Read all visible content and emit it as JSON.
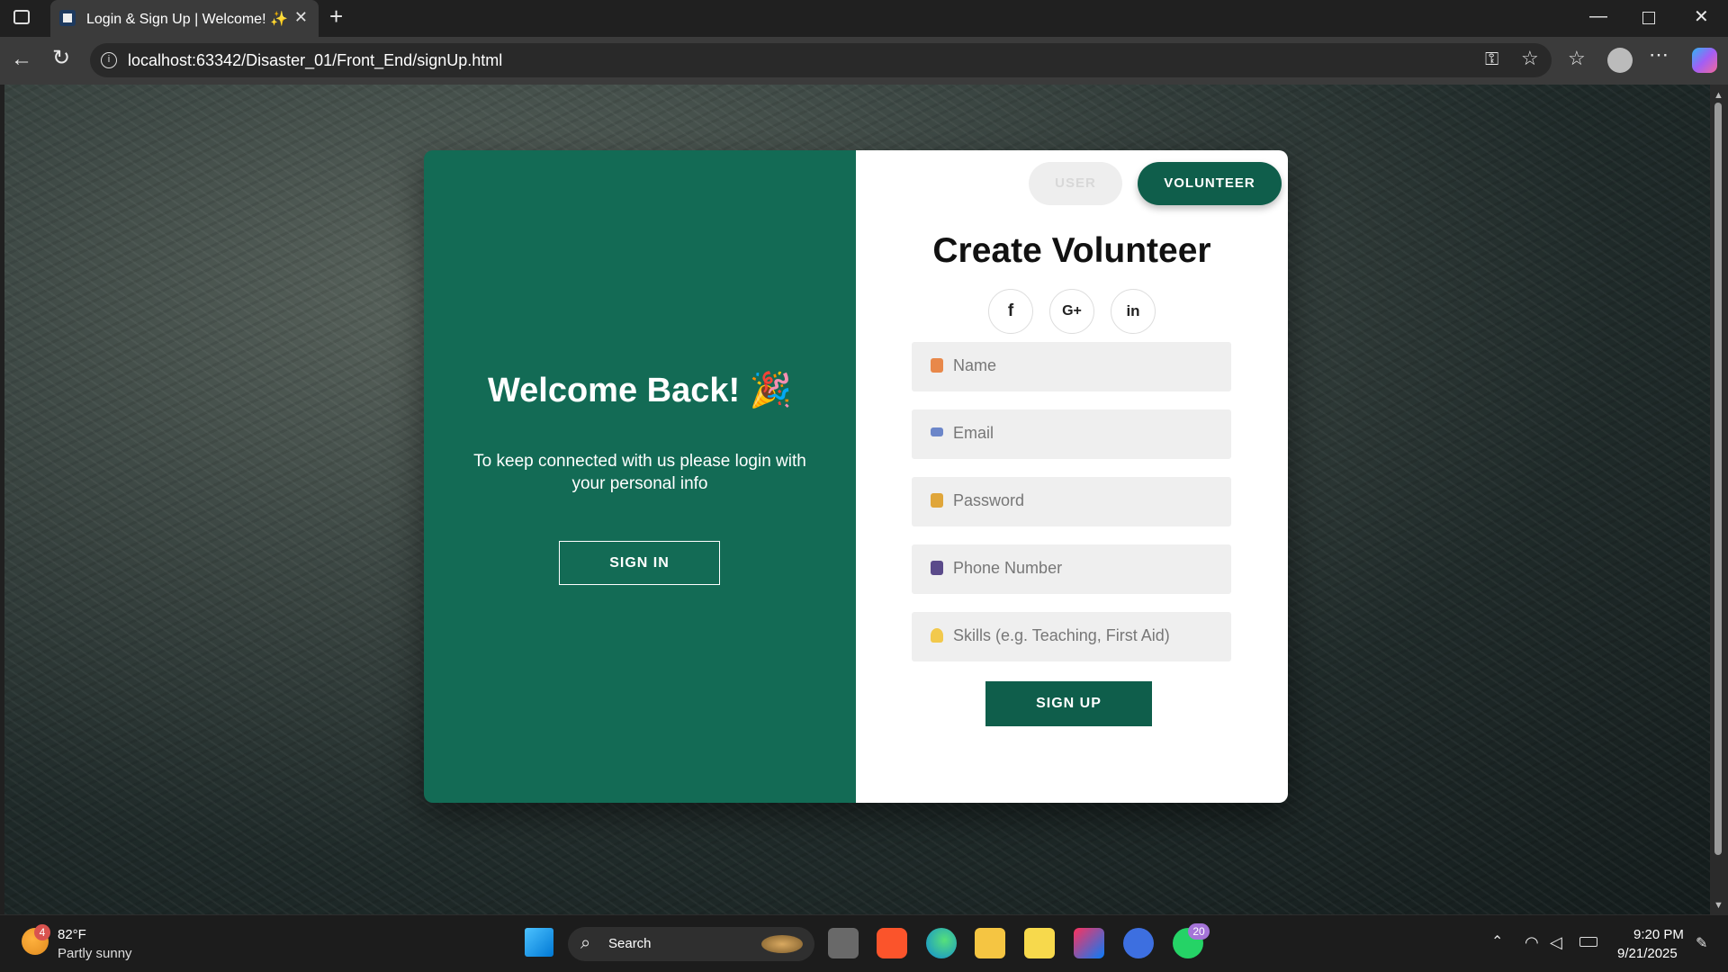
{
  "browser": {
    "tab_title": "Login & Sign Up | Welcome! ✨",
    "url": "localhost:63342/Disaster_01/Front_End/signUp.html"
  },
  "left_panel": {
    "heading": "Welcome Back! 🎉",
    "text": "To keep connected with us please login with your personal info",
    "signin_label": "SIGN IN"
  },
  "right_panel": {
    "role_tabs": {
      "user": "USER",
      "volunteer": "VOLUNTEER"
    },
    "title": "Create Volunteer",
    "social": {
      "facebook": "f",
      "google": "G+",
      "linkedin": "in"
    },
    "fields": {
      "name": "Name",
      "email": "Email",
      "password": "Password",
      "phone": "Phone Number",
      "skills": "Skills (e.g. Teaching, First Aid)"
    },
    "signup_label": "SIGN UP"
  },
  "taskbar": {
    "weather_temp": "82°F",
    "weather_desc": "Partly sunny",
    "weather_badge": "4",
    "search": "Search",
    "whatsapp_badge": "20",
    "time": "9:20 PM",
    "date": "9/21/2025"
  },
  "colors": {
    "panel_green": "#136b55",
    "button_green": "#0f5e4b"
  }
}
